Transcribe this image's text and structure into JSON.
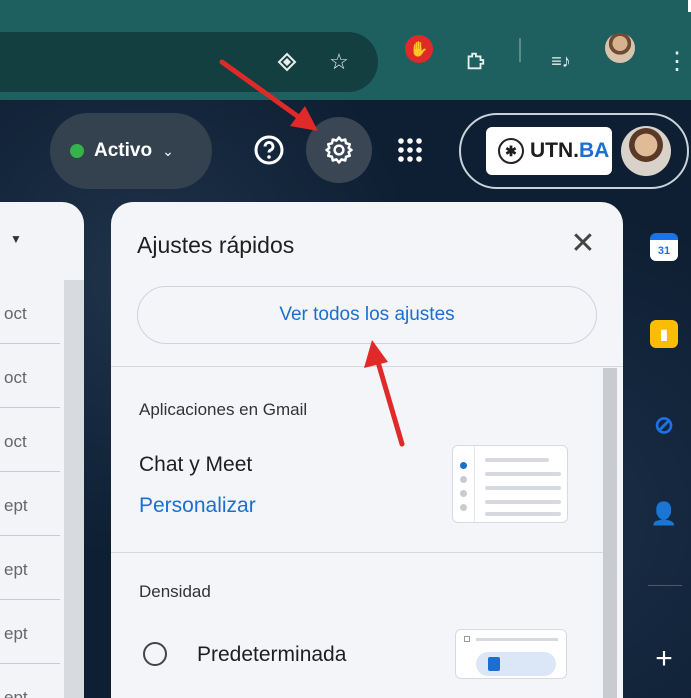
{
  "browser": {
    "icons": [
      "translate-icon",
      "bookmark-star-icon",
      "extension-block-icon",
      "extensions-puzzle-icon",
      "reading-list-icon",
      "profile-avatar",
      "more-vert-icon"
    ]
  },
  "header": {
    "status_label": "Activo",
    "status_color": "#36b24a",
    "org_name_prefix": "UTN.",
    "org_name_suffix": "BA"
  },
  "mail_list": {
    "dates": [
      "oct",
      "oct",
      "oct",
      "ept",
      "ept",
      "ept",
      "ept"
    ]
  },
  "quick_settings": {
    "title": "Ajustes rápidos",
    "see_all_label": "Ver todos los ajustes",
    "apps_section_label": "Aplicaciones en Gmail",
    "chat_meet_label": "Chat y Meet",
    "customize_link": "Personalizar",
    "density_section_label": "Densidad",
    "density_default_label": "Predeterminada"
  },
  "side_rail": {
    "calendar_day": "31",
    "add_label": "+"
  },
  "colors": {
    "accent_blue": "#1a6fd1",
    "annotation_red": "#e02a2a"
  }
}
